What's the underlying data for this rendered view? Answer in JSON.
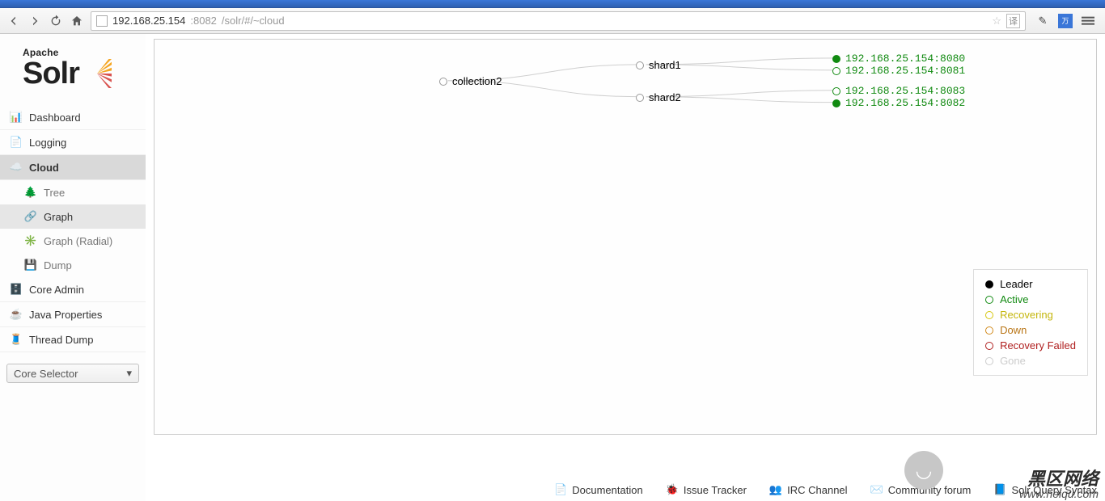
{
  "browser": {
    "url_base": "192.168.25.154",
    "url_port": ":8082",
    "url_path": "/solr/#/~cloud"
  },
  "logo": {
    "line1": "Apache",
    "line2": "Solr"
  },
  "nav": {
    "dashboard": "Dashboard",
    "logging": "Logging",
    "cloud": "Cloud",
    "tree": "Tree",
    "graph": "Graph",
    "graph_radial": "Graph (Radial)",
    "dump": "Dump",
    "core_admin": "Core Admin",
    "java_properties": "Java Properties",
    "thread_dump": "Thread Dump",
    "core_selector": "Core Selector"
  },
  "graph": {
    "collection": "collection2",
    "shard1": "shard1",
    "shard2": "shard2",
    "s1r1": "192.168.25.154:8080",
    "s1r2": "192.168.25.154:8081",
    "s2r1": "192.168.25.154:8083",
    "s2r2": "192.168.25.154:8082"
  },
  "legend": {
    "leader": "Leader",
    "active": "Active",
    "recovering": "Recovering",
    "down": "Down",
    "recovery_failed": "Recovery Failed",
    "gone": "Gone"
  },
  "footer": {
    "documentation": "Documentation",
    "issue_tracker": "Issue Tracker",
    "irc": "IRC Channel",
    "forum": "Community forum",
    "query_syntax": "Solr Query Syntax"
  },
  "watermark": {
    "line1": "黑区网络",
    "line2": "www.heiqu.com"
  }
}
